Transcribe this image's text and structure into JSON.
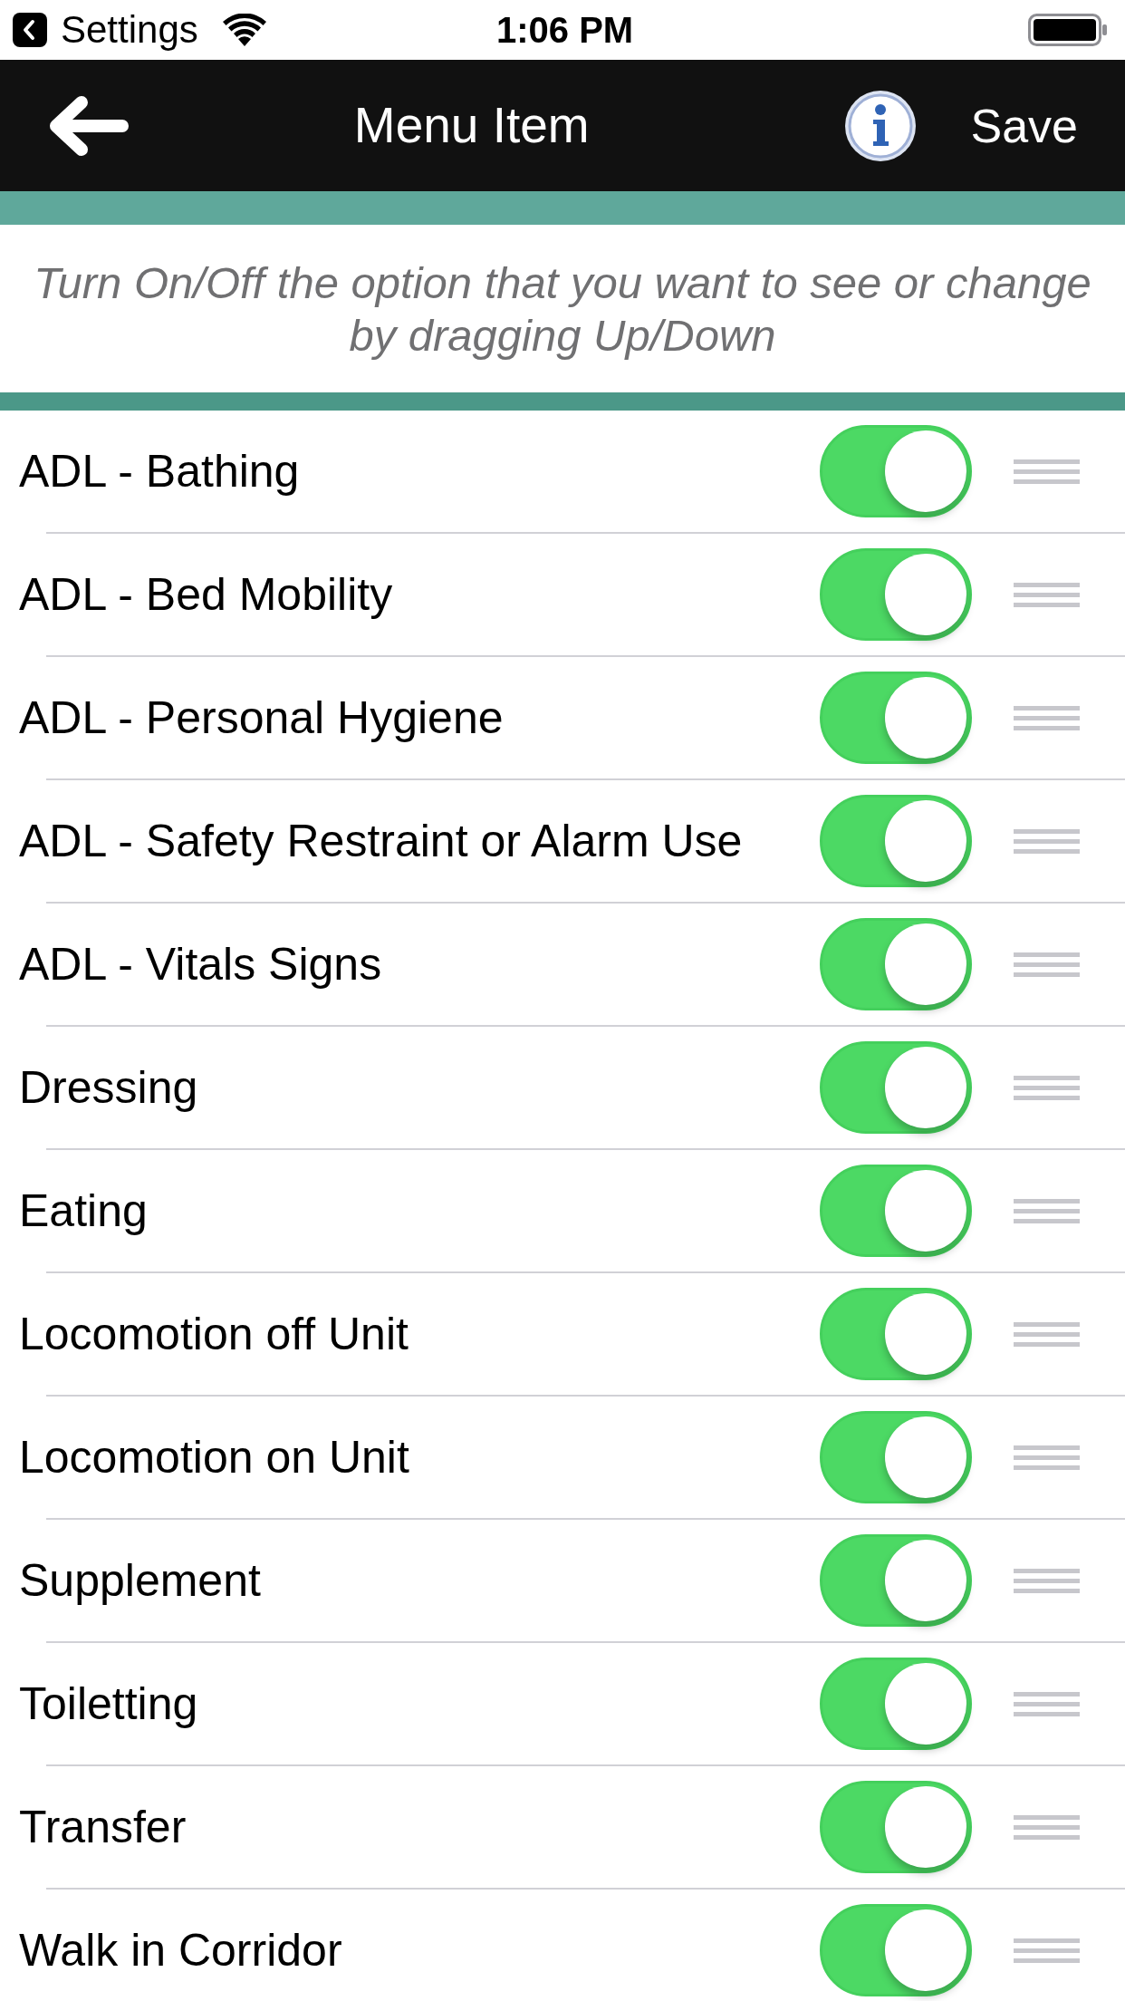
{
  "status_bar": {
    "back_label": "Settings",
    "time": "1:06 PM"
  },
  "nav_bar": {
    "title": "Menu Item",
    "save": "Save"
  },
  "instruction": "Turn On/Off the option that you want to see or change by dragging Up/Down",
  "items": [
    {
      "label": "ADL - Bathing",
      "on": true
    },
    {
      "label": "ADL - Bed Mobility",
      "on": true
    },
    {
      "label": "ADL - Personal Hygiene",
      "on": true
    },
    {
      "label": "ADL - Safety Restraint or Alarm Use",
      "on": true
    },
    {
      "label": "ADL - Vitals Signs",
      "on": true
    },
    {
      "label": "Dressing",
      "on": true
    },
    {
      "label": "Eating",
      "on": true
    },
    {
      "label": "Locomotion off Unit",
      "on": true
    },
    {
      "label": "Locomotion on Unit",
      "on": true
    },
    {
      "label": "Supplement",
      "on": true
    },
    {
      "label": "Toiletting",
      "on": true
    },
    {
      "label": "Transfer",
      "on": true
    },
    {
      "label": "Walk in Corridor",
      "on": true
    }
  ]
}
